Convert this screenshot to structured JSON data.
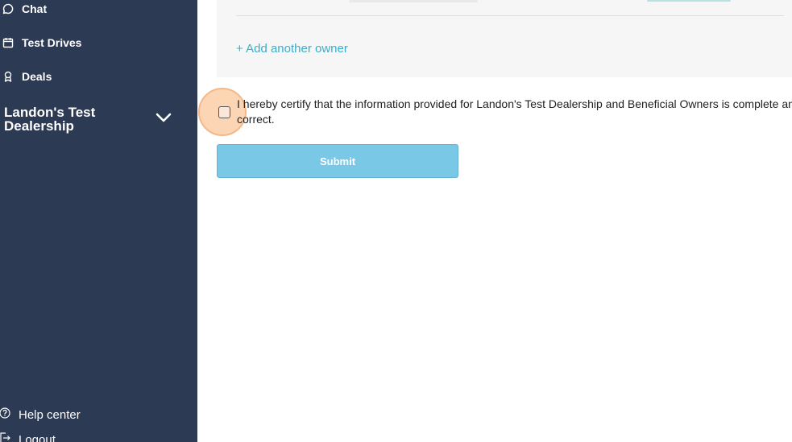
{
  "sidebar": {
    "nav": [
      {
        "label": "Chat",
        "icon": "chat-icon"
      },
      {
        "label": "Test Drives",
        "icon": "calendar-icon"
      },
      {
        "label": "Deals",
        "icon": "badge-icon"
      }
    ],
    "dealership": {
      "name": "Landon's Test Dealership"
    },
    "bottom": [
      {
        "label": "Help center",
        "icon": "help-icon"
      },
      {
        "label": "Logout",
        "icon": "logout-icon"
      }
    ]
  },
  "owners": {
    "add_label": "+ Add another owner"
  },
  "certification": {
    "text": "I hereby certify that the information provided for Landon's Test Dealership and Beneficial Owners is complete and correct.",
    "checked": false
  },
  "form": {
    "submit_label": "Submit"
  },
  "colors": {
    "sidebar_bg": "#2d3a54",
    "accent": "#3aafc8",
    "submit_bg": "#79c9e6",
    "highlight": "#f6b887"
  }
}
